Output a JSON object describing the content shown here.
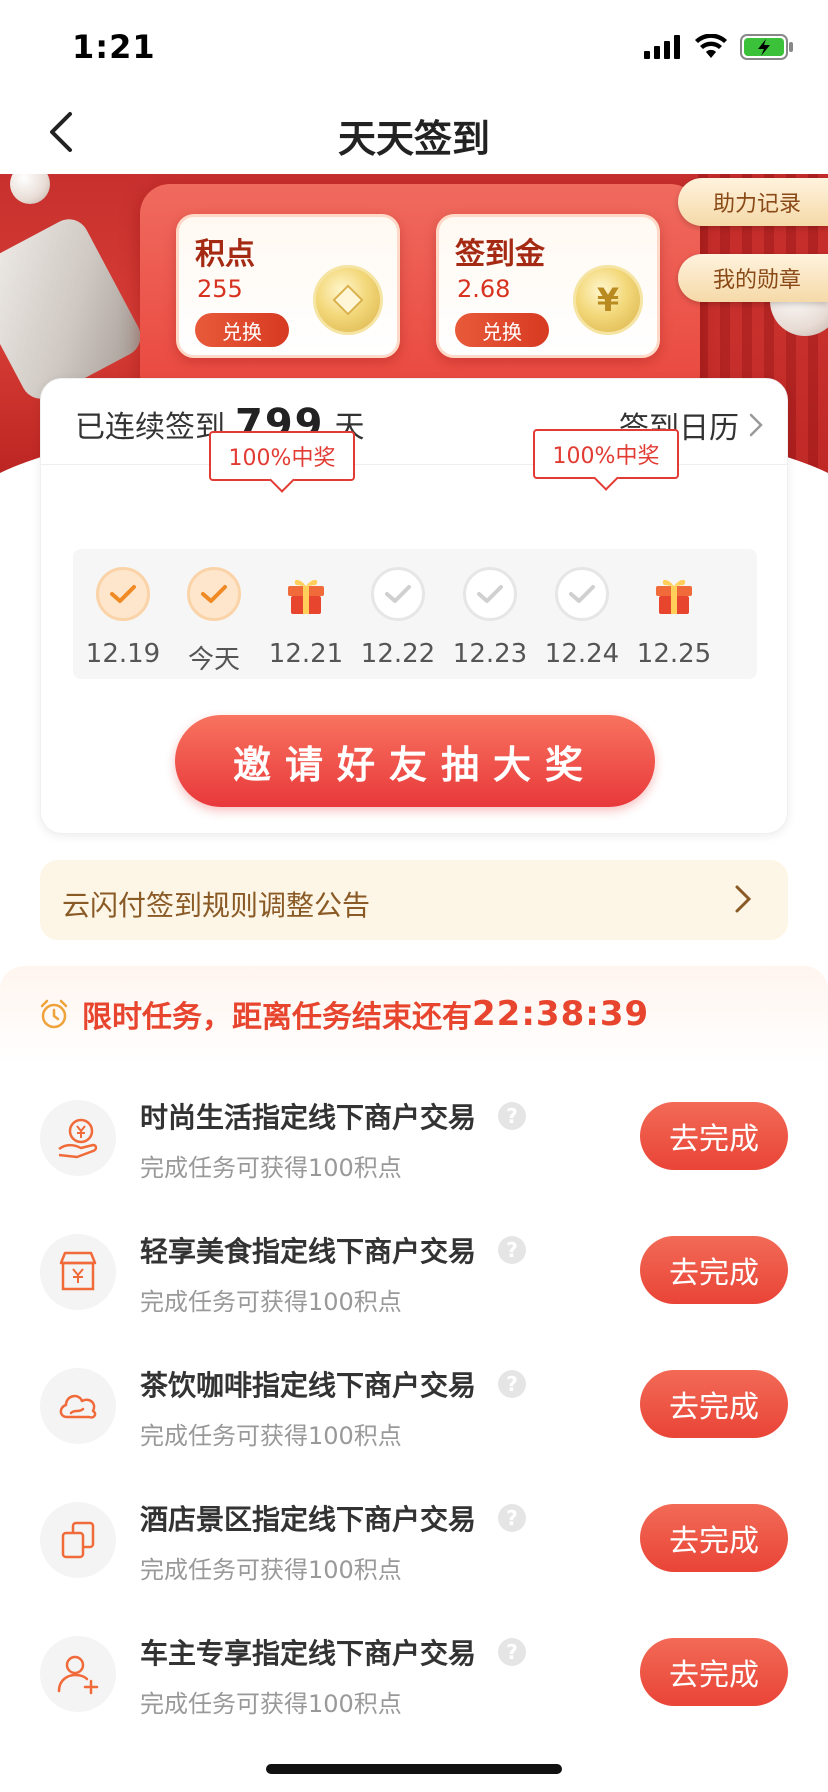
{
  "status_bar": {
    "time": "1:21"
  },
  "nav": {
    "title": "天天签到"
  },
  "banner": {
    "side_links": [
      "助力记录",
      "我的勋章"
    ],
    "cards": [
      {
        "label": "积点",
        "value": "255",
        "button": "兑换",
        "coin_icon": "diamond-coin-icon"
      },
      {
        "label": "签到金",
        "value": "2.68",
        "button": "兑换",
        "coin_icon": "yen-coin-icon",
        "coin_symbol": "¥"
      }
    ]
  },
  "checkin": {
    "streak_prefix": "已连续签到",
    "streak_days": "799",
    "streak_suffix": "天",
    "calendar_link": "签到日历",
    "prize_tags": [
      "100%中奖",
      "100%中奖"
    ],
    "days": [
      {
        "label": "12.19",
        "state": "done"
      },
      {
        "label": "今天",
        "state": "done"
      },
      {
        "label": "12.21",
        "state": "gift"
      },
      {
        "label": "12.22",
        "state": "pending"
      },
      {
        "label": "12.23",
        "state": "pending"
      },
      {
        "label": "12.24",
        "state": "pending"
      },
      {
        "label": "12.25",
        "state": "gift"
      }
    ],
    "invite_button": "邀请好友抽大奖"
  },
  "notice": {
    "text": "云闪付签到规则调整公告"
  },
  "tasks": {
    "header": "限时任务，距离任务结束还有",
    "countdown": "22:38:39",
    "items": [
      {
        "title": "时尚生活指定线下商户交易",
        "subtitle": "完成任务可获得100积点",
        "button": "去完成",
        "icon": "yen-hand-icon"
      },
      {
        "title": "轻享美食指定线下商户交易",
        "subtitle": "完成任务可获得100积点",
        "button": "去完成",
        "icon": "shop-icon"
      },
      {
        "title": "茶饮咖啡指定线下商户交易",
        "subtitle": "完成任务可获得100积点",
        "button": "去完成",
        "icon": "cloud-icon"
      },
      {
        "title": "酒店景区指定线下商户交易",
        "subtitle": "完成任务可获得100积点",
        "button": "去完成",
        "icon": "copy-icon"
      },
      {
        "title": "车主专享指定线下商户交易",
        "subtitle": "完成任务可获得100积点",
        "button": "去完成",
        "icon": "user-add-icon"
      }
    ]
  },
  "colors": {
    "accent": "#e8452f",
    "brand_red": "#d73d36",
    "gold": "#d9b14a"
  }
}
